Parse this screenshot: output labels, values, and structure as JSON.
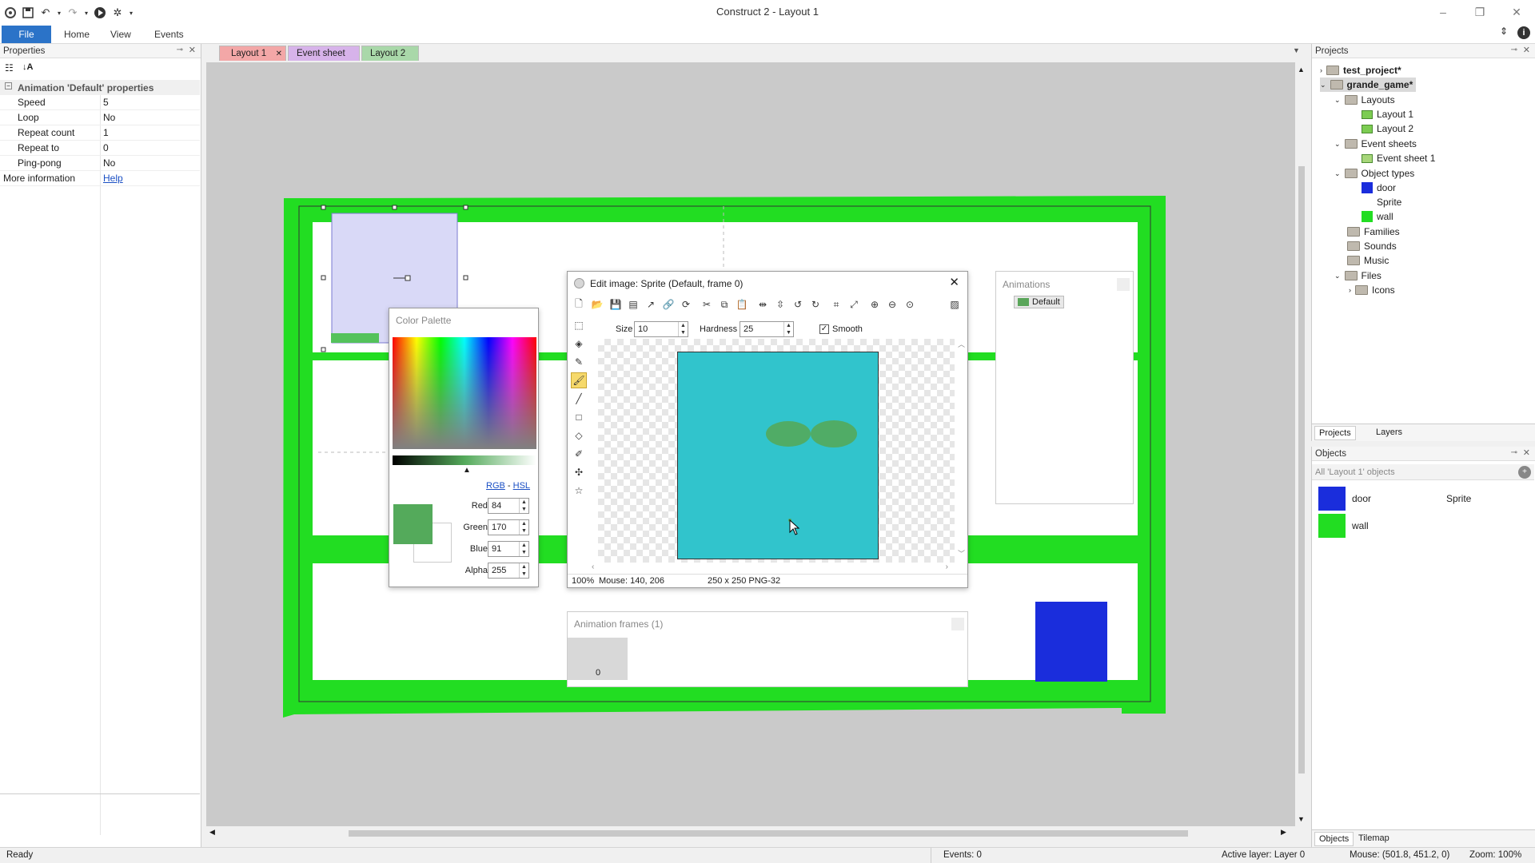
{
  "app": {
    "title": "Construct 2 - Layout 1",
    "ribbon_tabs": [
      "File",
      "Home",
      "View",
      "Events"
    ]
  },
  "properties_panel": {
    "title": "Properties",
    "section": "Animation 'Default' properties",
    "rows": [
      {
        "key": "Speed",
        "value": "5"
      },
      {
        "key": "Loop",
        "value": "No"
      },
      {
        "key": "Repeat count",
        "value": "1"
      },
      {
        "key": "Repeat to",
        "value": "0"
      },
      {
        "key": "Ping-pong",
        "value": "No"
      }
    ],
    "more_info_label": "More information",
    "more_info_link": "Help"
  },
  "doc_tabs": [
    "Layout 1",
    "Event sheet 1",
    "Layout 2"
  ],
  "color_palette": {
    "title": "Color Palette",
    "mode_rgb": "RGB",
    "mode_sep": " - ",
    "mode_hsl": "HSL",
    "red_label": "Red:",
    "red": "84",
    "green_label": "Green:",
    "green": "170",
    "blue_label": "Blue:",
    "blue": "91",
    "alpha_label": "Alpha:",
    "alpha": "255",
    "current_color": "#54aa5b"
  },
  "edit_image": {
    "title": "Edit image: Sprite (Default, frame 0)",
    "size_label": "Size",
    "size": "10",
    "hardness_label": "Hardness",
    "hardness": "25",
    "smooth_label": "Smooth",
    "smooth_checked": true,
    "canvas_color": "#31c4cc",
    "status_zoom": "100%",
    "status_mouse": "Mouse: 140, 206",
    "status_dims": "250 x 250  PNG-32"
  },
  "animations": {
    "title": "Animations",
    "items": [
      "Default"
    ]
  },
  "animation_frames": {
    "title": "Animation frames (1)",
    "frames": [
      "0"
    ]
  },
  "projects_panel": {
    "title": "Projects",
    "tree": [
      {
        "label": "test_project*",
        "bold": true
      },
      {
        "label": "grande_game*",
        "bold": true
      },
      {
        "label": "Layouts"
      },
      {
        "label": "Layout 1"
      },
      {
        "label": "Layout 2"
      },
      {
        "label": "Event sheets"
      },
      {
        "label": "Event sheet 1"
      },
      {
        "label": "Object types"
      },
      {
        "label": "door"
      },
      {
        "label": "Sprite"
      },
      {
        "label": "wall"
      },
      {
        "label": "Families"
      },
      {
        "label": "Sounds"
      },
      {
        "label": "Music"
      },
      {
        "label": "Files"
      },
      {
        "label": "Icons"
      }
    ],
    "tabs": [
      "Projects",
      "Layers"
    ]
  },
  "objects_panel": {
    "title": "Objects",
    "filter": "All 'Layout 1' objects",
    "items": [
      {
        "name": "door",
        "color": "#1a2ddc"
      },
      {
        "name": "Sprite",
        "color": ""
      },
      {
        "name": "wall",
        "color": "#22dd22"
      }
    ],
    "tabs": [
      "Objects",
      "Tilemap"
    ]
  },
  "statusbar": {
    "ready": "Ready",
    "events": "Events: 0",
    "active_layer": "Active layer: Layer 0",
    "mouse": "Mouse: (501.8, 451.2, 0)",
    "zoom": "Zoom: 100%"
  },
  "colors": {
    "wall": "#22dd22",
    "door": "#1a2ddc",
    "accent": "#2b73c8"
  }
}
